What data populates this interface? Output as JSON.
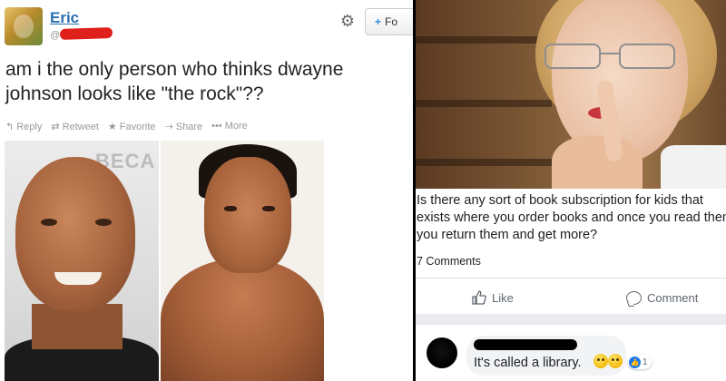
{
  "tweet": {
    "user_name": "Eric",
    "handle_prefix": "@",
    "follow_label": "Fo",
    "follow_icon": "+",
    "gear_icon": "⚙",
    "text_line1": "am i the only person who thinks dwayne",
    "text_line2": "johnson looks like \"the rock\"??",
    "actions": {
      "reply": "Reply",
      "retweet": "Retweet",
      "favorite": "Favorite",
      "share": "Share",
      "more": "More"
    },
    "watermark": "BECA"
  },
  "fb": {
    "post_line1": "Is there any sort of book subscription for kids that",
    "post_line2": "exists where you order books and once you read them",
    "post_line3": "you return them and get more?",
    "comments_count": "7 Comments",
    "like_label": "Like",
    "comment_label": "Comment",
    "comment": {
      "text": "It's called a library.",
      "reaction_count": "1"
    }
  },
  "colors": {
    "link_blue": "#2a6fb0",
    "redaction_red": "#e0201b",
    "fb_blue": "#1877f2"
  }
}
